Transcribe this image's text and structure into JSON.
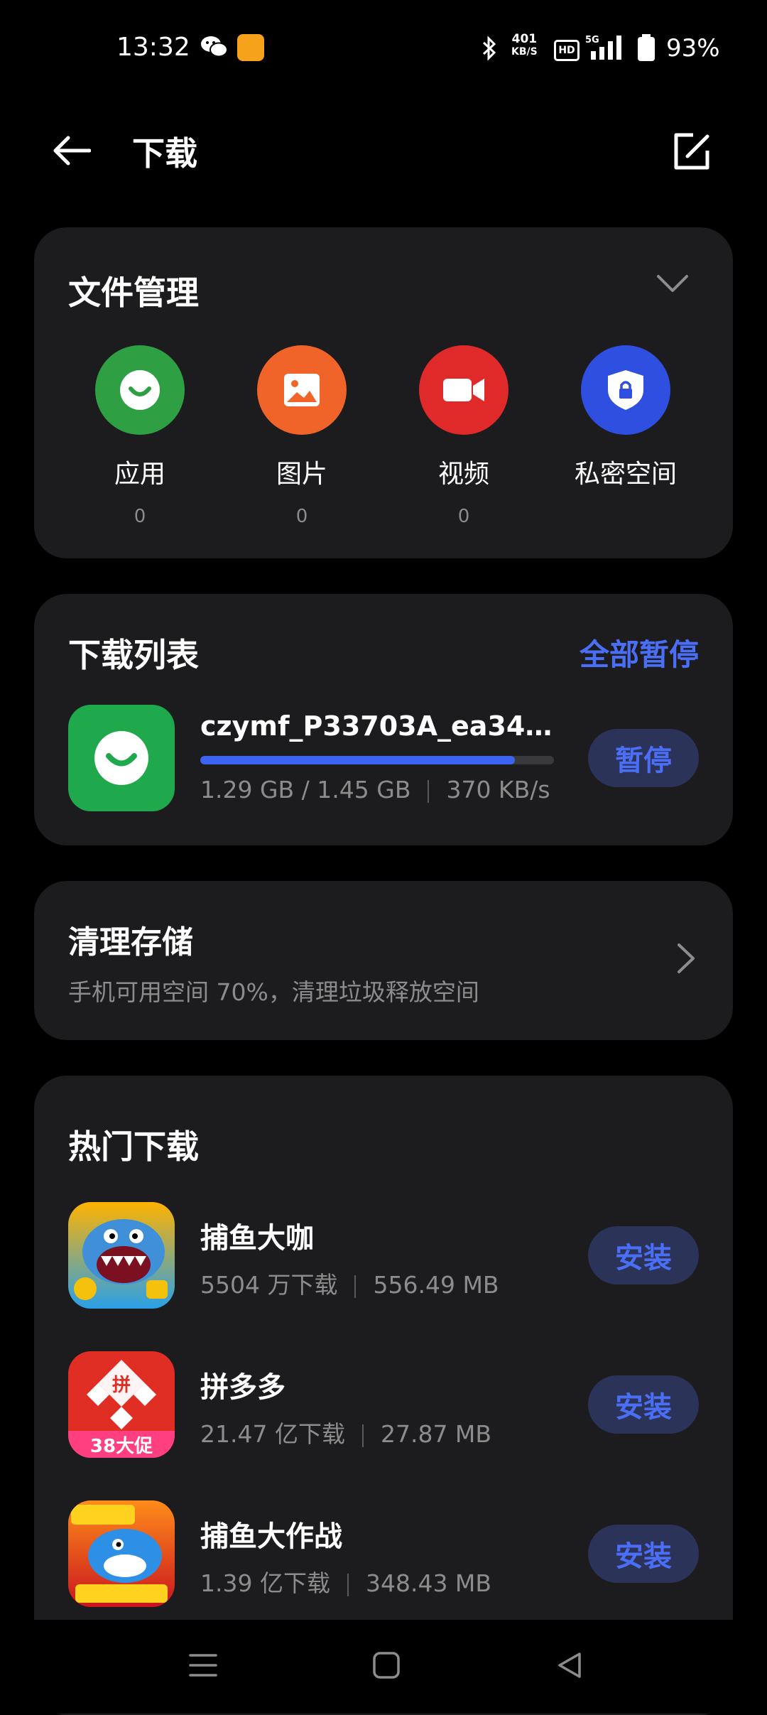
{
  "status_bar": {
    "time": "13:32",
    "net_speed_value": "401",
    "net_speed_unit": "KB/S",
    "hd": "HD",
    "network": "5G",
    "battery": "93%"
  },
  "header": {
    "title": "下载"
  },
  "file_management": {
    "title": "文件管理",
    "categories": [
      {
        "label": "应用",
        "count": "0",
        "color": "#2ea043",
        "icon": "app-store-icon"
      },
      {
        "label": "图片",
        "count": "0",
        "color": "#f0642a",
        "icon": "image-icon"
      },
      {
        "label": "视频",
        "count": "0",
        "color": "#e02a2a",
        "icon": "video-camera-icon"
      },
      {
        "label": "私密空间",
        "count": "",
        "color": "#2f4fe0",
        "icon": "lock-shield-icon"
      }
    ]
  },
  "download_list": {
    "title": "下载列表",
    "pause_all": "全部暂停",
    "item": {
      "name": "czymf_P33703A_ea34f4...",
      "downloaded": "1.29 GB / 1.45 GB",
      "speed": "370 KB/s",
      "progress": 0.89,
      "action": "暂停"
    }
  },
  "clean_storage": {
    "title": "清理存储",
    "subtitle": "手机可用空间 70%，清理垃圾释放空间"
  },
  "hot_downloads": {
    "title": "热门下载",
    "apps": [
      {
        "name": "捕鱼大咖",
        "downloads": "5504 万下载",
        "size": "556.49 MB",
        "action": "安装"
      },
      {
        "name": "拼多多",
        "downloads": "21.47 亿下载",
        "size": "27.87 MB",
        "action": "安装"
      },
      {
        "name": "捕鱼大作战",
        "downloads": "1.39 亿下载",
        "size": "348.43 MB",
        "action": "安装"
      }
    ]
  },
  "colors": {
    "accent": "#4a6ef5",
    "background": "#000000",
    "card": "#1c1c1e"
  }
}
